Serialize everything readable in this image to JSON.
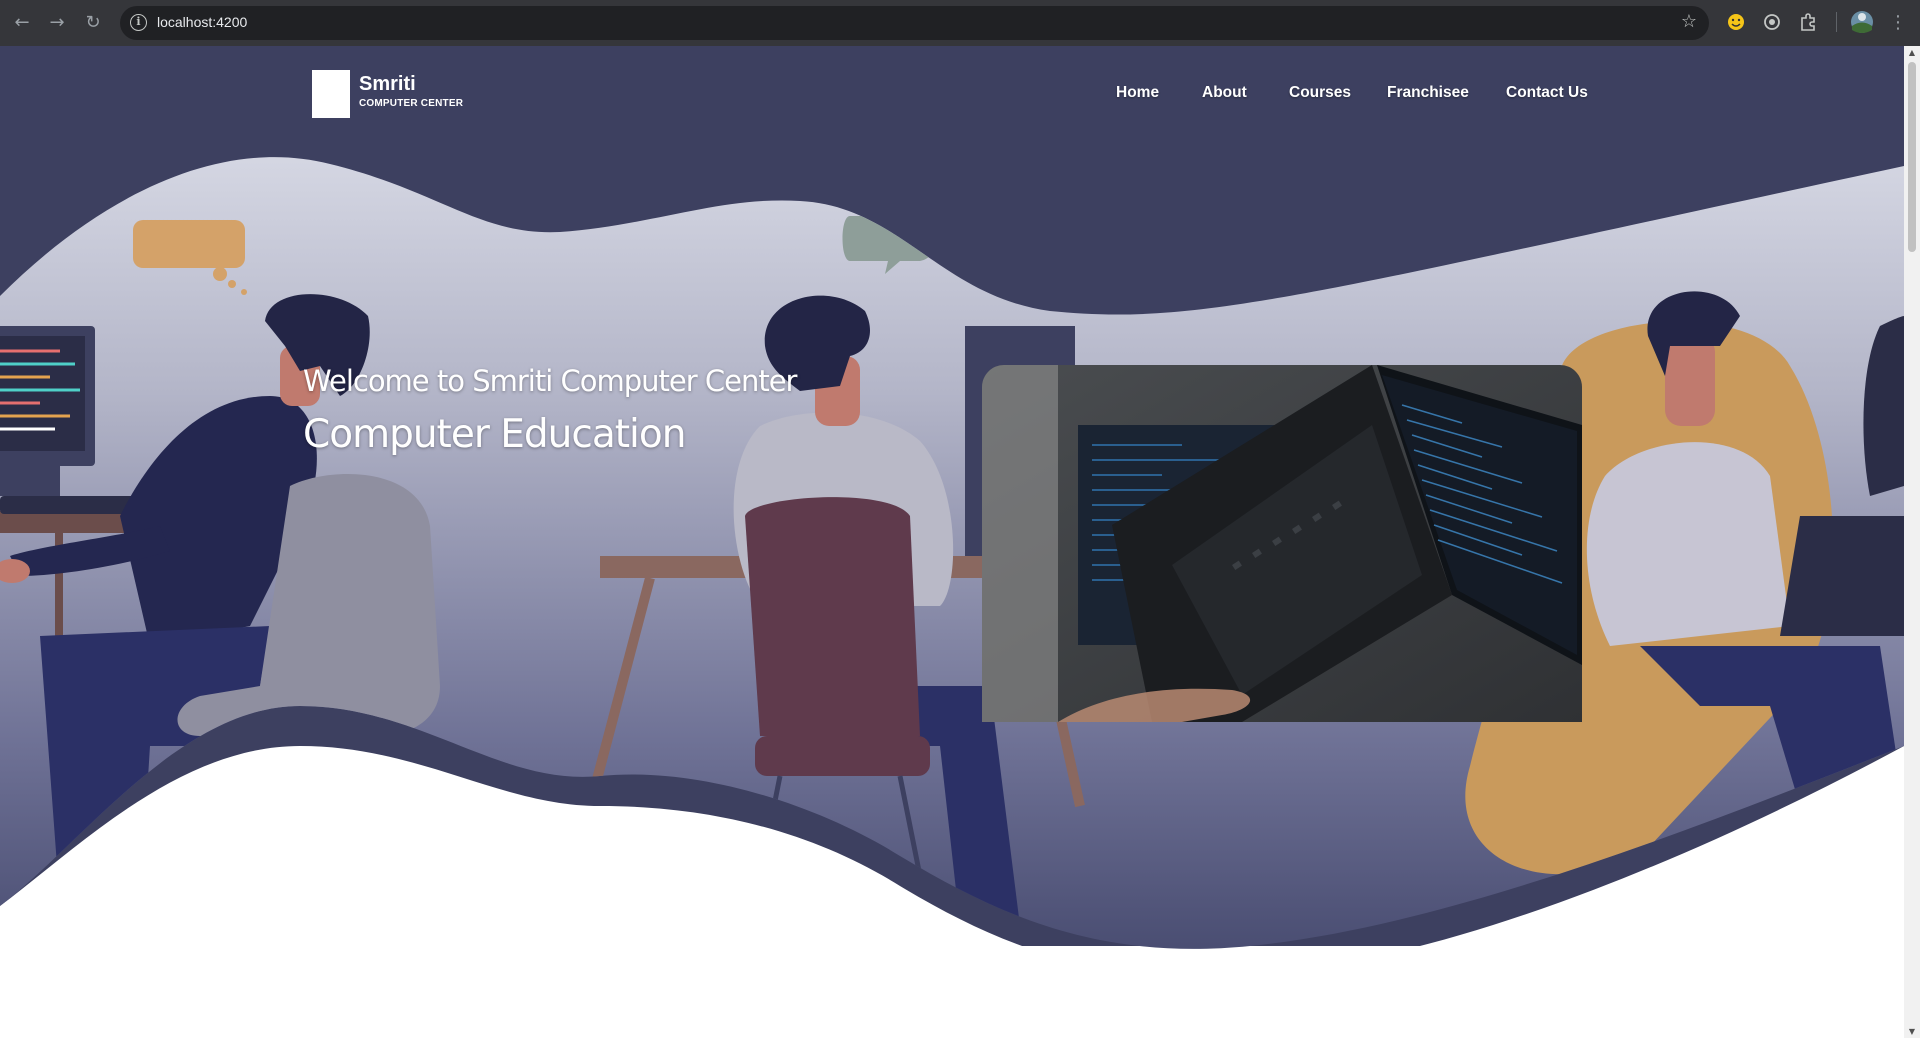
{
  "browser": {
    "url": "localhost:4200",
    "back_icon": "arrow-left-icon",
    "forward_icon": "arrow-right-icon",
    "reload_icon": "reload-icon",
    "star_icon": "bookmark-star-icon"
  },
  "header": {
    "brand_name": "Smriti",
    "brand_sub": "COMPUTER CENTER",
    "nav": [
      "Home",
      "About",
      "Courses",
      "Franchisee",
      "Contact Us"
    ]
  },
  "hero": {
    "welcome": "Welcome to Smriti Computer Center",
    "headline": "Computer Education",
    "speech_bubble_text": "• • •"
  },
  "colors": {
    "navy": "#3d4060",
    "hair": "#232546",
    "skin": "#c07a6e",
    "mustard": "#c99a5c",
    "white": "#ffffff"
  }
}
